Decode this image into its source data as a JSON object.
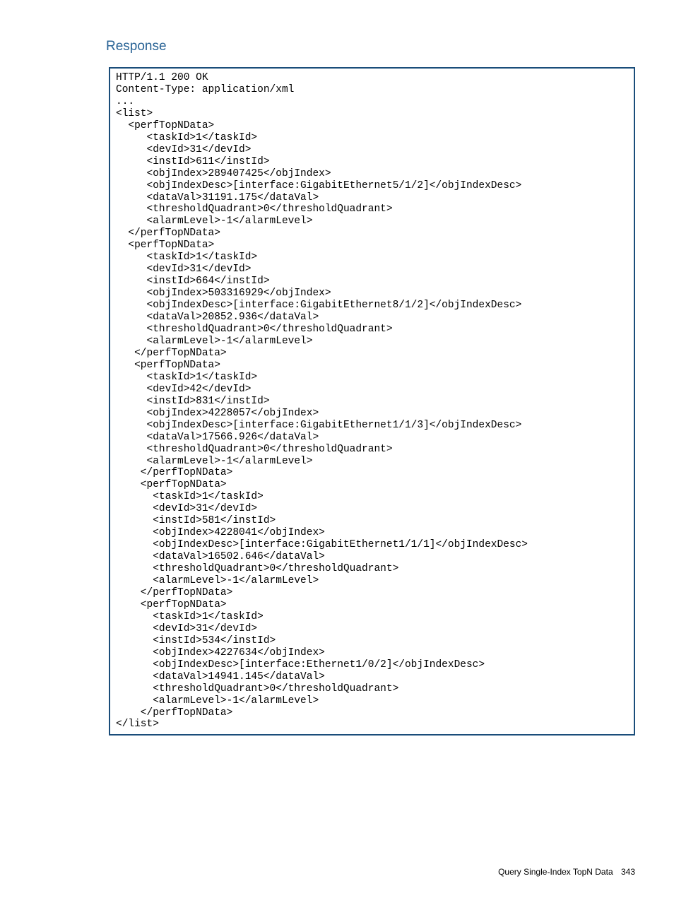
{
  "section_title": "Response",
  "code": "HTTP/1.1 200 OK\nContent-Type: application/xml\n...\n<list>\n  <perfTopNData>\n     <taskId>1</taskId>\n     <devId>31</devId>\n     <instId>611</instId>\n     <objIndex>289407425</objIndex>\n     <objIndexDesc>[interface:GigabitEthernet5/1/2]</objIndexDesc>\n     <dataVal>31191.175</dataVal>\n     <thresholdQuadrant>0</thresholdQuadrant>\n     <alarmLevel>-1</alarmLevel>\n  </perfTopNData>\n  <perfTopNData>\n     <taskId>1</taskId>\n     <devId>31</devId>\n     <instId>664</instId>\n     <objIndex>503316929</objIndex>\n     <objIndexDesc>[interface:GigabitEthernet8/1/2]</objIndexDesc>\n     <dataVal>20852.936</dataVal>\n     <thresholdQuadrant>0</thresholdQuadrant>\n     <alarmLevel>-1</alarmLevel>\n   </perfTopNData>\n   <perfTopNData>\n     <taskId>1</taskId>\n     <devId>42</devId>\n     <instId>831</instId>\n     <objIndex>4228057</objIndex>\n     <objIndexDesc>[interface:GigabitEthernet1/1/3]</objIndexDesc>\n     <dataVal>17566.926</dataVal>\n     <thresholdQuadrant>0</thresholdQuadrant>\n     <alarmLevel>-1</alarmLevel>\n    </perfTopNData>\n    <perfTopNData>\n      <taskId>1</taskId>\n      <devId>31</devId>\n      <instId>581</instId>\n      <objIndex>4228041</objIndex>\n      <objIndexDesc>[interface:GigabitEthernet1/1/1]</objIndexDesc>\n      <dataVal>16502.646</dataVal>\n      <thresholdQuadrant>0</thresholdQuadrant>\n      <alarmLevel>-1</alarmLevel>\n    </perfTopNData>\n    <perfTopNData>\n      <taskId>1</taskId>\n      <devId>31</devId>\n      <instId>534</instId>\n      <objIndex>4227634</objIndex>\n      <objIndexDesc>[interface:Ethernet1/0/2]</objIndexDesc>\n      <dataVal>14941.145</dataVal>\n      <thresholdQuadrant>0</thresholdQuadrant>\n      <alarmLevel>-1</alarmLevel>\n    </perfTopNData>\n</list>",
  "footer": {
    "text": "Query Single-Index TopN Data",
    "page": "343"
  }
}
